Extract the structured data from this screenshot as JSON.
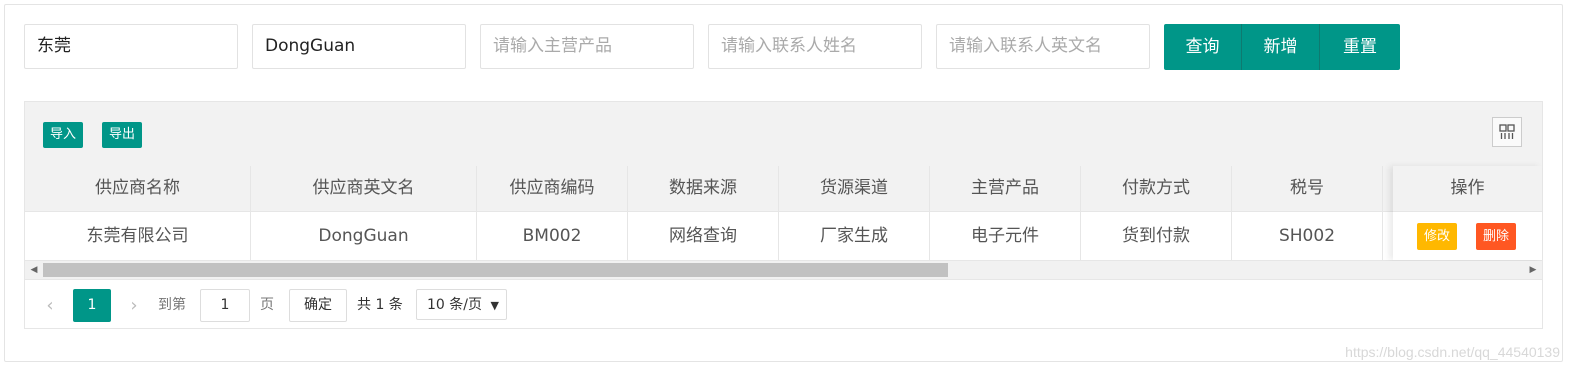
{
  "search": {
    "field1_value": "东莞",
    "field2_value": "DongGuan",
    "field3_placeholder": "请输入主营产品",
    "field4_placeholder": "请输入联系人姓名",
    "field5_placeholder": "请输入联系人英文名"
  },
  "buttons": {
    "query": "查询",
    "add": "新增",
    "reset": "重置"
  },
  "toolbar": {
    "import": "导入",
    "export": "导出",
    "columns_icon": "grid-columns-icon"
  },
  "table": {
    "columns": [
      "供应商名称",
      "供应商英文名",
      "供应商编码",
      "数据来源",
      "货源渠道",
      "主营产品",
      "付款方式",
      "税号"
    ],
    "action_header": "操作",
    "rows": [
      {
        "cells": [
          "东莞有限公司",
          "DongGuan",
          "BM002",
          "网络查询",
          "厂家生成",
          "电子元件",
          "货到付款",
          "SH002"
        ],
        "edit": "修改",
        "delete": "删除"
      }
    ]
  },
  "pagination": {
    "current_page": "1",
    "goto_label": "到第",
    "goto_value": "1",
    "page_unit": "页",
    "confirm": "确定",
    "total": "共 1 条",
    "page_size": "10 条/页"
  },
  "watermark": "https://blog.csdn.net/qq_44540139",
  "colors": {
    "primary": "#009688",
    "warn": "#ffb800",
    "danger": "#ff5722"
  }
}
